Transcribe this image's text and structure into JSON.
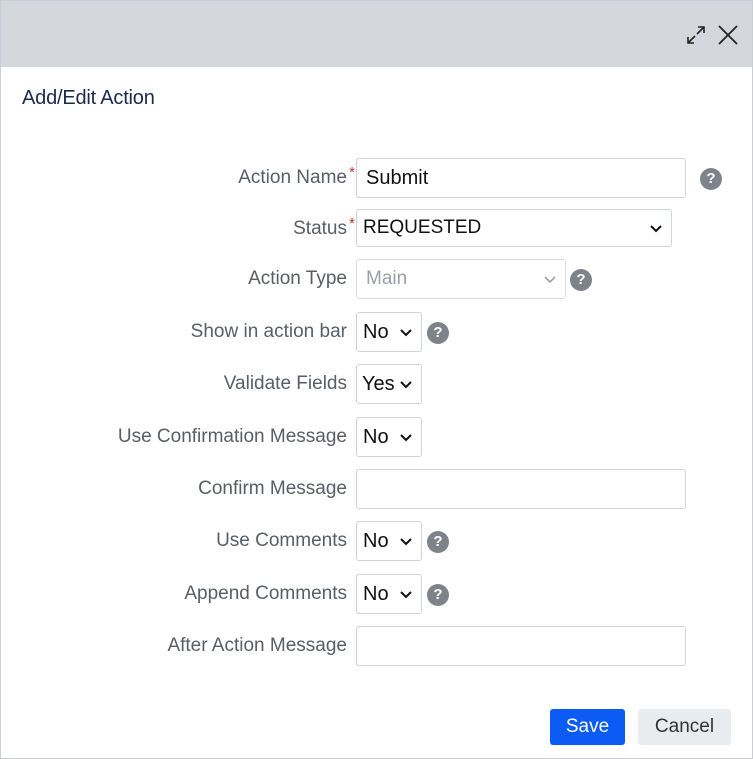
{
  "window": {
    "title": "Add/Edit Action"
  },
  "icons": {
    "maximize": "expand-arrows-icon",
    "close": "close-icon",
    "help": "question-circle-icon",
    "dropdown": "chevron-down-icon"
  },
  "fields": {
    "action_name": {
      "label": "Action Name",
      "required_mark": "*",
      "value": "Submit"
    },
    "status": {
      "label": "Status",
      "required_mark": "*",
      "value": "REQUESTED"
    },
    "action_type": {
      "label": "Action Type",
      "value": "Main"
    },
    "show_in_action_bar": {
      "label": "Show in action bar",
      "value": "No"
    },
    "validate_fields": {
      "label": "Validate Fields",
      "value": "Yes"
    },
    "use_confirmation_message": {
      "label": "Use Confirmation Message",
      "value": "No"
    },
    "confirm_message": {
      "label": "Confirm Message",
      "value": ""
    },
    "use_comments": {
      "label": "Use Comments",
      "value": "No"
    },
    "append_comments": {
      "label": "Append Comments",
      "value": "No"
    },
    "after_action_message": {
      "label": "After Action Message",
      "value": ""
    }
  },
  "help_glyph": "?",
  "buttons": {
    "save": "Save",
    "cancel": "Cancel"
  },
  "colors": {
    "accent": "#0a5cf5",
    "titlebar": "#d4d8dc",
    "title_text": "#1b2a4a"
  }
}
